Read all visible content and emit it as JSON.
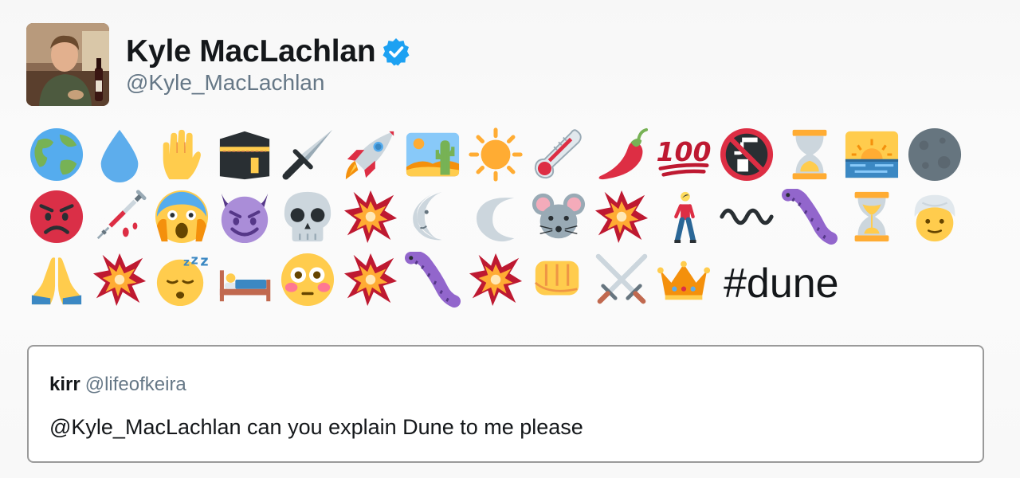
{
  "tweet": {
    "author": {
      "display_name": "Kyle MacLachlan",
      "screen_name": "@Kyle_MacLachlan",
      "verified": true,
      "avatar_icon": "profile-photo"
    },
    "hashtag": "#dune",
    "emoji_rows": [
      [
        "globe-asia-australia",
        "droplet",
        "raised-hand",
        "kaaba",
        "dagger",
        "rocket",
        "desert",
        "sun",
        "thermometer",
        "hot-pepper",
        "hundred-points",
        "non-potable-water",
        "hourglass-done",
        "sunrise",
        "new-moon"
      ],
      [
        "angry-face",
        "syringe",
        "screaming-face",
        "smiling-devil",
        "skull",
        "collision",
        "last-quarter-moon-face",
        "crescent-moon",
        "mouse-face",
        "collision",
        "person-walking",
        "wavy-dash",
        "bug",
        "hourglass-flowing",
        "person-with-turban"
      ],
      [
        "folded-hands",
        "collision",
        "sleeping-face",
        "bed",
        "flushed-face",
        "collision",
        "bug",
        "collision",
        "oncoming-fist",
        "crossed-swords",
        "crown"
      ]
    ]
  },
  "quoted_tweet": {
    "name": "kirr",
    "screen_name": "@lifeofkeira",
    "text": "@Kyle_MacLachlan can you explain Dune to me please"
  },
  "colors": {
    "verified_blue": "#1da1f2",
    "secondary_text": "#657786",
    "primary_text": "#14171a",
    "quote_border": "#9a9a9a"
  }
}
